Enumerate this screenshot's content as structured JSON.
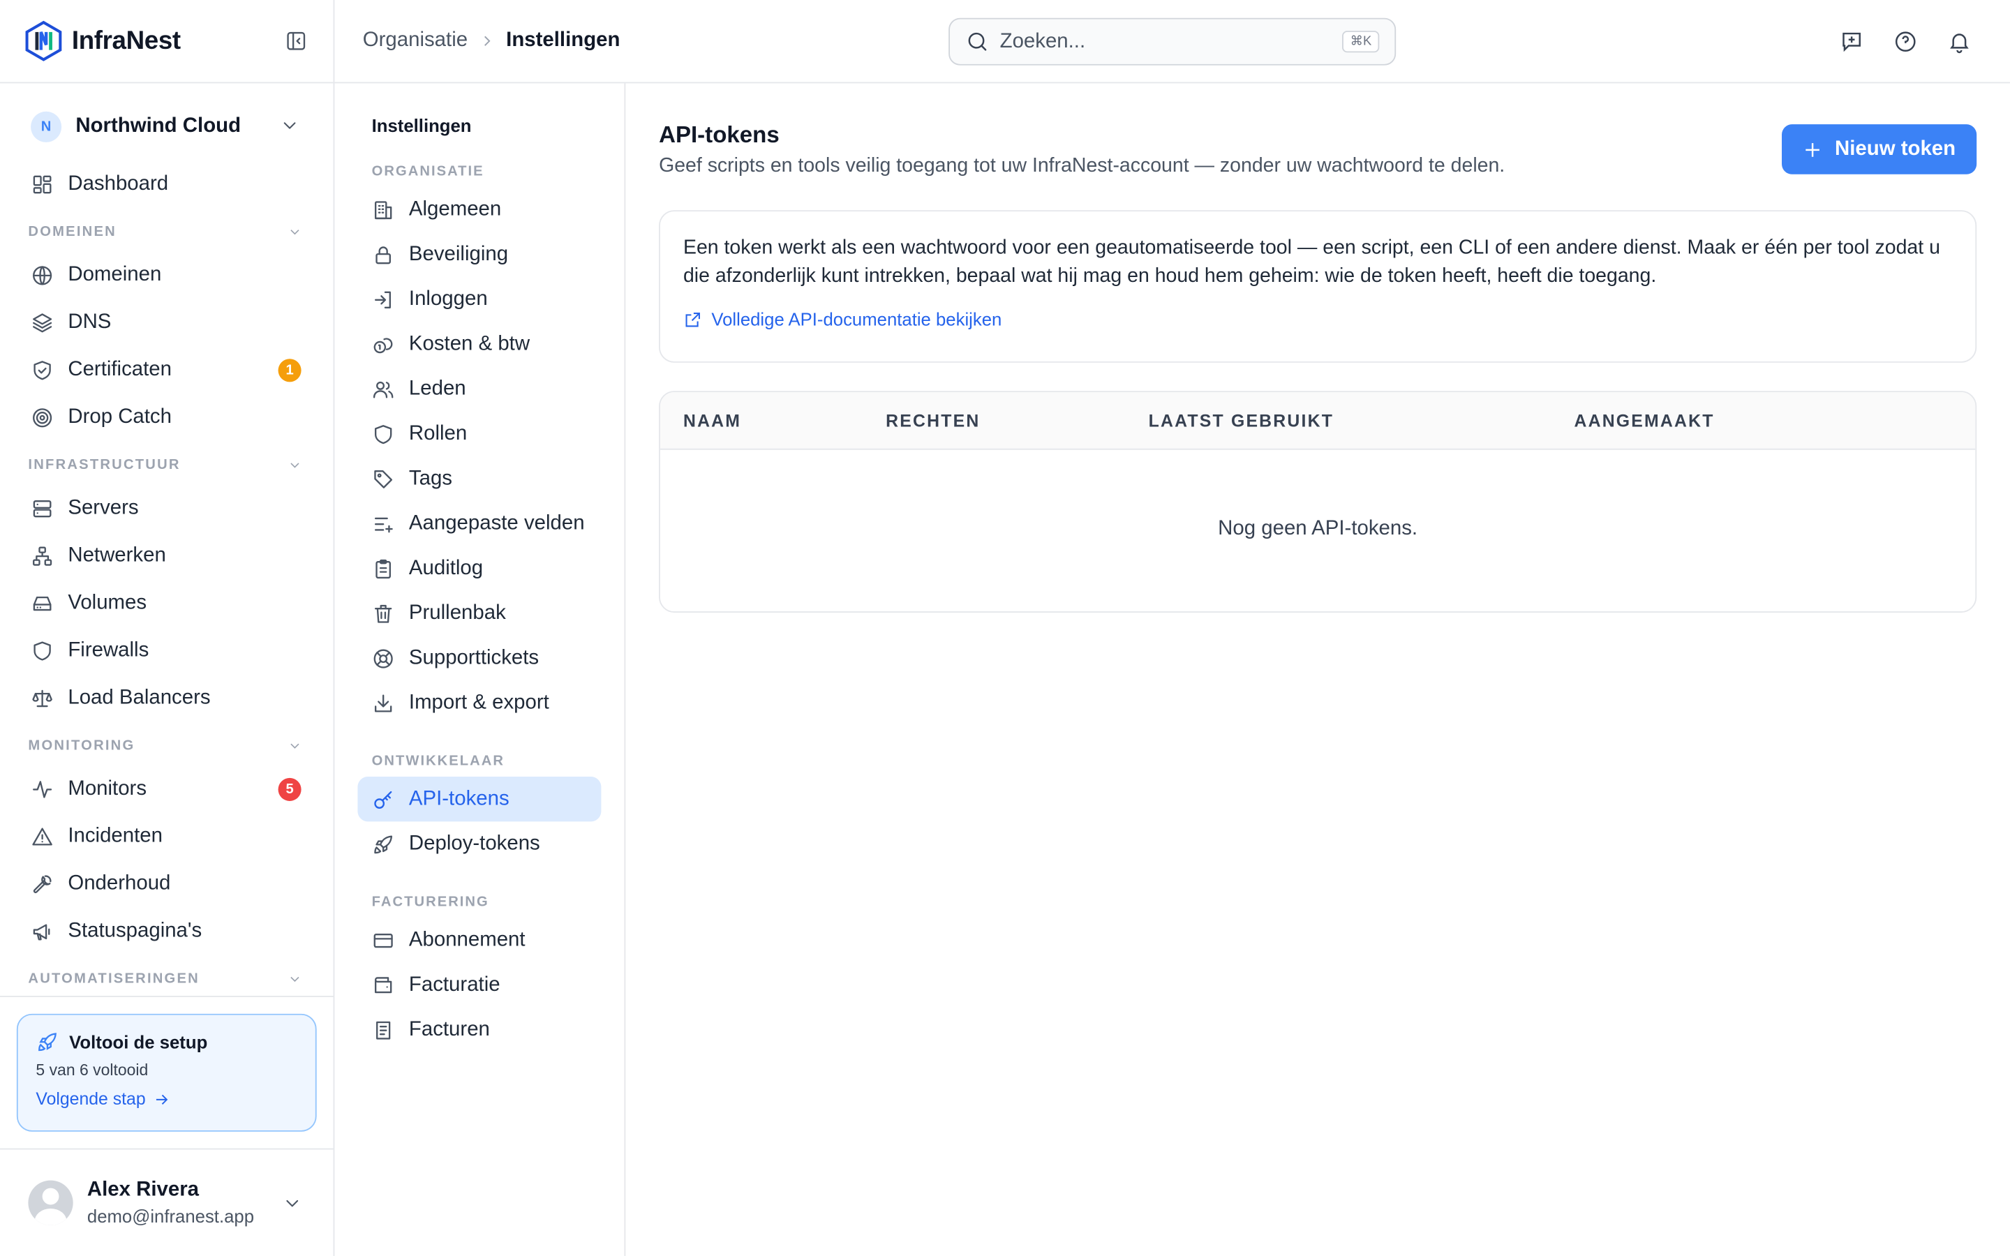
{
  "brand": {
    "name": "InfraNest"
  },
  "org": {
    "initial": "N",
    "name": "Northwind Cloud"
  },
  "sidebar": {
    "top_items": [
      {
        "label": "Dashboard",
        "icon": "dashboard-icon"
      }
    ],
    "sections": [
      {
        "label": "DOMEINEN",
        "items": [
          {
            "label": "Domeinen"
          },
          {
            "label": "DNS"
          },
          {
            "label": "Certificaten",
            "badge": "1"
          },
          {
            "label": "Drop Catch"
          }
        ]
      },
      {
        "label": "INFRASTRUCTUUR",
        "items": [
          {
            "label": "Servers"
          },
          {
            "label": "Netwerken"
          },
          {
            "label": "Volumes"
          },
          {
            "label": "Firewalls"
          },
          {
            "label": "Load Balancers"
          }
        ]
      },
      {
        "label": "MONITORING",
        "items": [
          {
            "label": "Monitors",
            "badge": "5"
          },
          {
            "label": "Incidenten"
          },
          {
            "label": "Onderhoud"
          },
          {
            "label": "Statuspagina's"
          }
        ]
      },
      {
        "label": "AUTOMATISERINGEN",
        "items": []
      }
    ],
    "badge_colors": {
      "warning": "#f59e0b",
      "danger": "#ef4444"
    }
  },
  "setup": {
    "title": "Voltooi de setup",
    "progress_text": "5 van 6 voltooid",
    "next_label": "Volgende stap",
    "completed": 5,
    "total": 6
  },
  "user": {
    "name": "Alex Rivera",
    "email": "demo@infranest.app"
  },
  "header": {
    "breadcrumb": [
      "Organisatie",
      "Instellingen"
    ],
    "search_placeholder": "Zoeken...",
    "search_shortcut": "⌘K"
  },
  "subnav": {
    "title": "Instellingen",
    "groups": [
      {
        "label": "ORGANISATIE",
        "items": [
          "Algemeen",
          "Beveiliging",
          "Inloggen",
          "Kosten & btw",
          "Leden",
          "Rollen",
          "Tags",
          "Aangepaste velden",
          "Auditlog",
          "Prullenbak",
          "Supporttickets",
          "Import & export"
        ]
      },
      {
        "label": "ONTWIKKELAAR",
        "items": [
          "API-tokens",
          "Deploy-tokens"
        ]
      },
      {
        "label": "FACTURERING",
        "items": [
          "Abonnement",
          "Facturatie",
          "Facturen"
        ]
      }
    ],
    "active": "API-tokens"
  },
  "main": {
    "title": "API-tokens",
    "subtitle": "Geef scripts en tools veilig toegang tot uw InfraNest-account — zonder uw wachtwoord te delen.",
    "new_button": "Nieuw token",
    "info_text": "Een token werkt als een wachtwoord voor een geautomatiseerde tool — een script, een CLI of een andere dienst. Maak er één per tool zodat u die afzonderlijk kunt intrekken, bepaal wat hij mag en houd hem geheim: wie de token heeft, heeft die toegang.",
    "info_link": "Volledige API-documentatie bekijken",
    "table": {
      "columns": [
        "NAAM",
        "RECHTEN",
        "LAATST GEBRUIKT",
        "AANGEMAAKT"
      ],
      "empty_text": "Nog geen API-tokens."
    }
  },
  "colors": {
    "accent": "#3b82f6",
    "accent_light": "#dbeafe",
    "link": "#2563eb"
  }
}
